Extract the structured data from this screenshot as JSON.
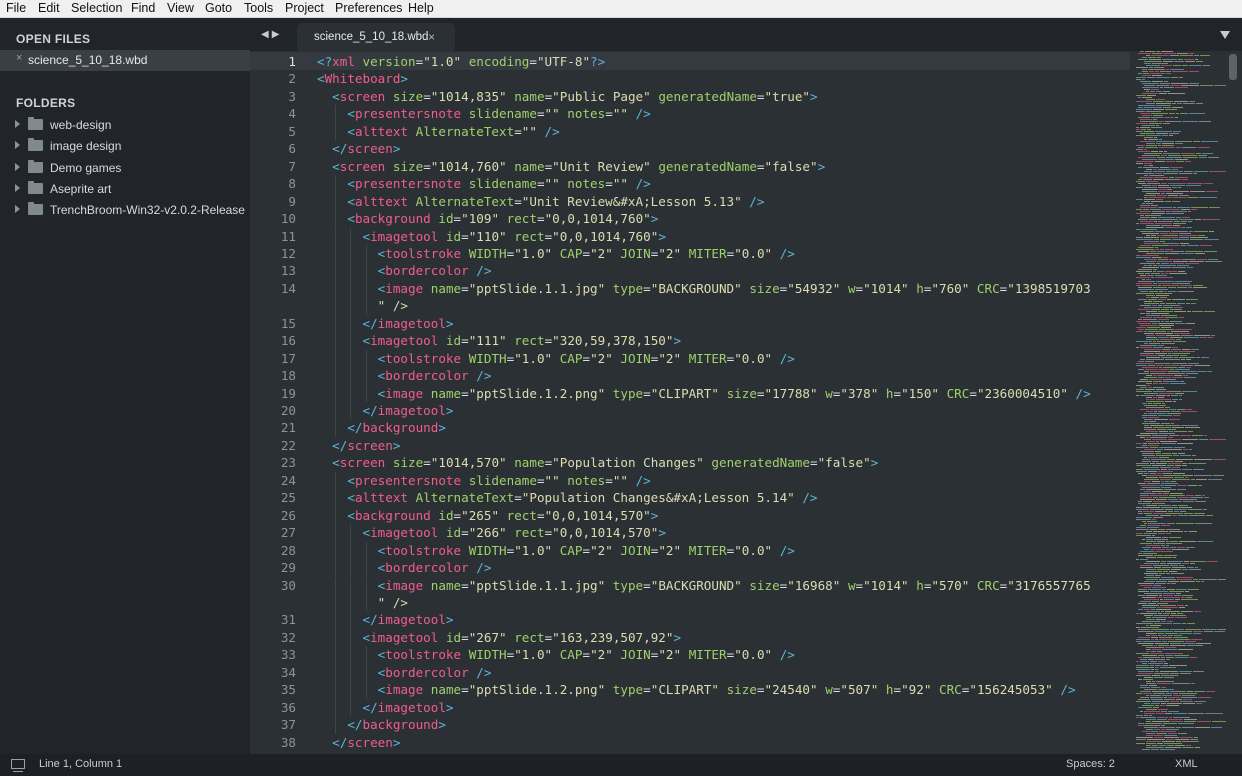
{
  "menu": [
    "File",
    "Edit",
    "Selection",
    "Find",
    "View",
    "Goto",
    "Tools",
    "Project",
    "Preferences",
    "Help"
  ],
  "sidebar": {
    "open_files_header": "OPEN FILES",
    "open_files": [
      {
        "close": "×",
        "name": "science_5_10_18.wbd"
      }
    ],
    "folders_header": "FOLDERS",
    "folders": [
      "web-design",
      "image design",
      "Demo games",
      "Aseprite art",
      "TrenchBroom-Win32-v2.0.2-Release"
    ]
  },
  "tabs": {
    "nav_arrows": "◀▶",
    "active": {
      "title": "science_5_10_18.wbd",
      "close": "×"
    }
  },
  "editor": {
    "current_line": 1,
    "rows": [
      {
        "ln": "1",
        "text": "<?xml version=\"1.0\" encoding=\"UTF-8\"?>"
      },
      {
        "ln": "2",
        "text": "<Whiteboard>"
      },
      {
        "ln": "3",
        "text": "  <screen size=\"1014,835\" name=\"Public Page\" generatedName=\"true\">"
      },
      {
        "ln": "4",
        "text": "    <presentersnote slidename=\"\" notes=\"\" />"
      },
      {
        "ln": "5",
        "text": "    <alttext AlternateText=\"\" />"
      },
      {
        "ln": "6",
        "text": "  </screen>"
      },
      {
        "ln": "7",
        "text": "  <screen size=\"1014,760\" name=\"Unit Review\" generatedName=\"false\">"
      },
      {
        "ln": "8",
        "text": "    <presentersnote slidename=\"\" notes=\"\" />"
      },
      {
        "ln": "9",
        "text": "    <alttext AlternateText=\"Unit Review&#xA;Lesson 5.13\" />"
      },
      {
        "ln": "10",
        "text": "    <background id=\"109\" rect=\"0,0,1014,760\">"
      },
      {
        "ln": "11",
        "text": "      <imagetool id=\"110\" rect=\"0,0,1014,760\">"
      },
      {
        "ln": "12",
        "text": "        <toolstroke WIDTH=\"1.0\" CAP=\"2\" JOIN=\"2\" MITER=\"0.0\" />"
      },
      {
        "ln": "13",
        "text": "        <bordercolor />"
      },
      {
        "ln": "14",
        "text": "        <image name=\"pptSlide.1.1.jpg\" type=\"BACKGROUND\" size=\"54932\" w=\"1014\" h=\"760\" CRC=\"1398519703"
      },
      {
        "ln": "",
        "text": "        \" />"
      },
      {
        "ln": "15",
        "text": "      </imagetool>"
      },
      {
        "ln": "16",
        "text": "      <imagetool id=\"111\" rect=\"320,59,378,150\">"
      },
      {
        "ln": "17",
        "text": "        <toolstroke WIDTH=\"1.0\" CAP=\"2\" JOIN=\"2\" MITER=\"0.0\" />"
      },
      {
        "ln": "18",
        "text": "        <bordercolor />"
      },
      {
        "ln": "19",
        "text": "        <image name=\"pptSlide.1.2.png\" type=\"CLIPART\" size=\"17788\" w=\"378\" h=\"150\" CRC=\"2360004510\" />"
      },
      {
        "ln": "20",
        "text": "      </imagetool>"
      },
      {
        "ln": "21",
        "text": "    </background>"
      },
      {
        "ln": "22",
        "text": "  </screen>"
      },
      {
        "ln": "23",
        "text": "  <screen size=\"1014,570\" name=\"Population Changes\" generatedName=\"false\">"
      },
      {
        "ln": "24",
        "text": "    <presentersnote slidename=\"\" notes=\"\" />"
      },
      {
        "ln": "25",
        "text": "    <alttext AlternateText=\"Population Changes&#xA;Lesson 5.14\" />"
      },
      {
        "ln": "26",
        "text": "    <background id=\"265\" rect=\"0,0,1014,570\">"
      },
      {
        "ln": "27",
        "text": "      <imagetool id=\"266\" rect=\"0,0,1014,570\">"
      },
      {
        "ln": "28",
        "text": "        <toolstroke WIDTH=\"1.0\" CAP=\"2\" JOIN=\"2\" MITER=\"0.0\" />"
      },
      {
        "ln": "29",
        "text": "        <bordercolor />"
      },
      {
        "ln": "30",
        "text": "        <image name=\"pptSlide.1.1.jpg\" type=\"BACKGROUND\" size=\"16968\" w=\"1014\" h=\"570\" CRC=\"3176557765"
      },
      {
        "ln": "",
        "text": "        \" />"
      },
      {
        "ln": "31",
        "text": "      </imagetool>"
      },
      {
        "ln": "32",
        "text": "      <imagetool id=\"267\" rect=\"163,239,507,92\">"
      },
      {
        "ln": "33",
        "text": "        <toolstroke WIDTH=\"1.0\" CAP=\"2\" JOIN=\"2\" MITER=\"0.0\" />"
      },
      {
        "ln": "34",
        "text": "        <bordercolor />"
      },
      {
        "ln": "35",
        "text": "        <image name=\"pptSlide.1.2.png\" type=\"CLIPART\" size=\"24540\" w=\"507\" h=\"92\" CRC=\"156245053\" />"
      },
      {
        "ln": "36",
        "text": "      </imagetool>"
      },
      {
        "ln": "37",
        "text": "    </background>"
      },
      {
        "ln": "38",
        "text": "  </screen>"
      }
    ]
  },
  "status": {
    "position": "Line 1, Column 1",
    "indentation": "Spaces: 2",
    "syntax": "XML"
  },
  "colors": {
    "tag": "#f05d8a",
    "attribute": "#9fd16b",
    "string": "#dcdcb0",
    "punctuation": "#5fb5d8",
    "text": "#d9dde0"
  }
}
